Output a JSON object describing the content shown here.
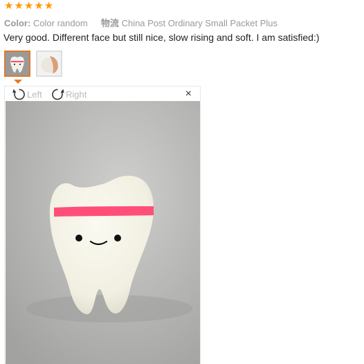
{
  "rating": {
    "stars": 5,
    "icon": "star-icon",
    "color": "#ff9900"
  },
  "meta": {
    "color_label": "Color:",
    "color_value": "Color random",
    "shipping_label": "物流",
    "shipping_value": "China Post Ordinary Small Packet Plus"
  },
  "review_text": "Very good. Different face but still nice, slow rising and soft. I am satisfied:)",
  "thumbnails": [
    {
      "name": "thumbnail-1",
      "active": true
    },
    {
      "name": "thumbnail-2",
      "active": false
    }
  ],
  "viewer": {
    "rotate_left_label": "Left",
    "rotate_right_label": "Right",
    "close_icon": "×"
  },
  "colors": {
    "accent": "#e07a2b",
    "text": "#222222",
    "muted": "#999999"
  }
}
